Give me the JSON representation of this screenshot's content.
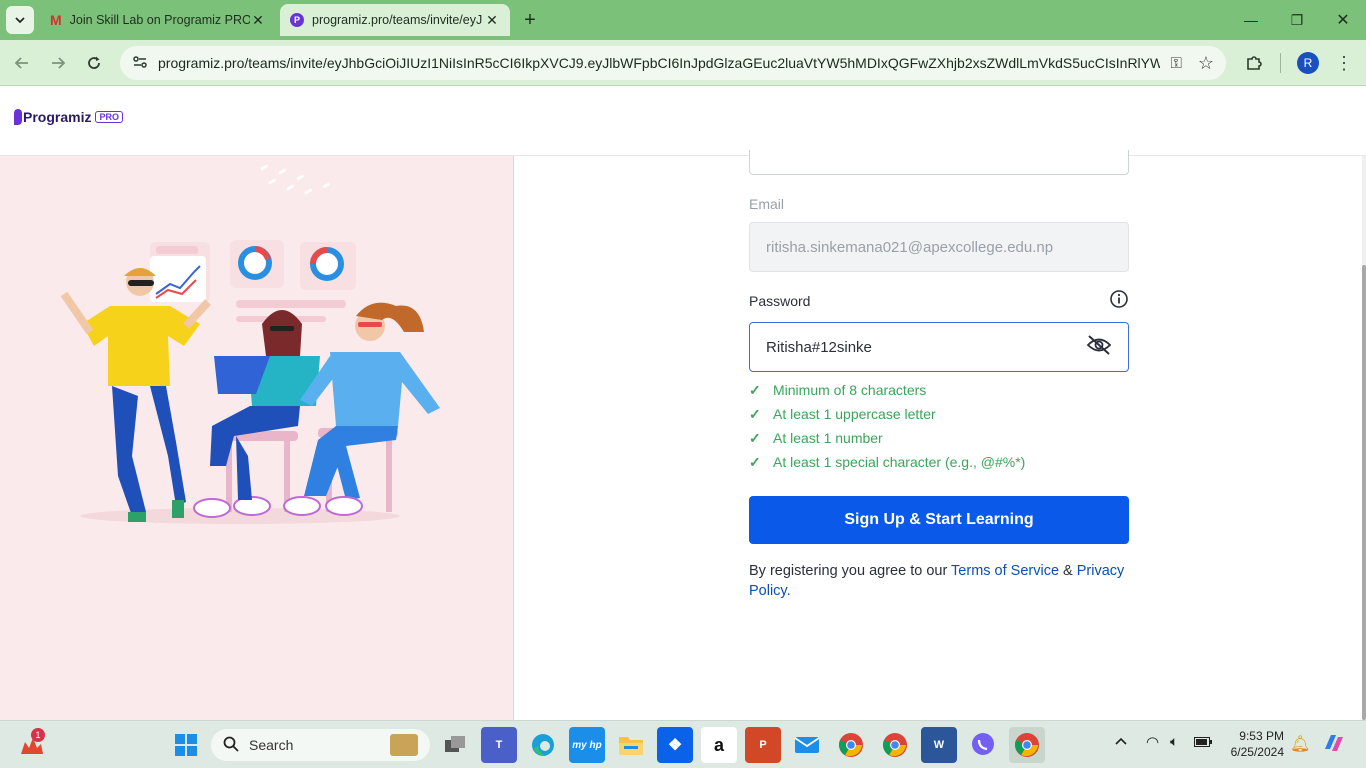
{
  "browser": {
    "tabs": [
      {
        "title": "Join Skill Lab on Programiz PRO",
        "active": false
      },
      {
        "title": "programiz.pro/teams/invite/eyJ",
        "active": true
      }
    ],
    "url": "programiz.pro/teams/invite/eyJhbGciOiJIUzI1NiIsInR5cCI6IkpXVCJ9.eyJlbWFpbCI6InJpdGlzaGEuc2luaVtYW5hMDIxQGFwZXhjb2xsZWdlLmVkdS5ucCIsInRlYW1J...",
    "profile_initial": "R"
  },
  "header": {
    "logo_text": "Programiz",
    "logo_badge": "PRO"
  },
  "form": {
    "email_label": "Email",
    "email_value": "ritisha.sinkemana021@apexcollege.edu.np",
    "password_label": "Password",
    "password_value": "Ritisha#12sinke",
    "requirements": [
      "Minimum of 8 characters",
      "At least 1 uppercase letter",
      "At least 1 number",
      "At least 1 special character (e.g., @#%*)"
    ],
    "submit_label": "Sign Up & Start Learning",
    "terms_prefix": "By registering you agree to our ",
    "terms_link": "Terms of Service",
    "terms_and": " & ",
    "privacy_link_1": "Privacy",
    "privacy_link_2": "Policy."
  },
  "taskbar": {
    "search_label": "Search",
    "time": "9:53 PM",
    "date": "6/25/2024",
    "notification_count": "1"
  },
  "colors": {
    "tabstrip": "#7cc17a",
    "toolbar": "#d9efd6",
    "left_pane": "#fbeaec",
    "primary_button": "#0a59e9",
    "check": "#3aa55a",
    "link": "#0a4fb3"
  }
}
